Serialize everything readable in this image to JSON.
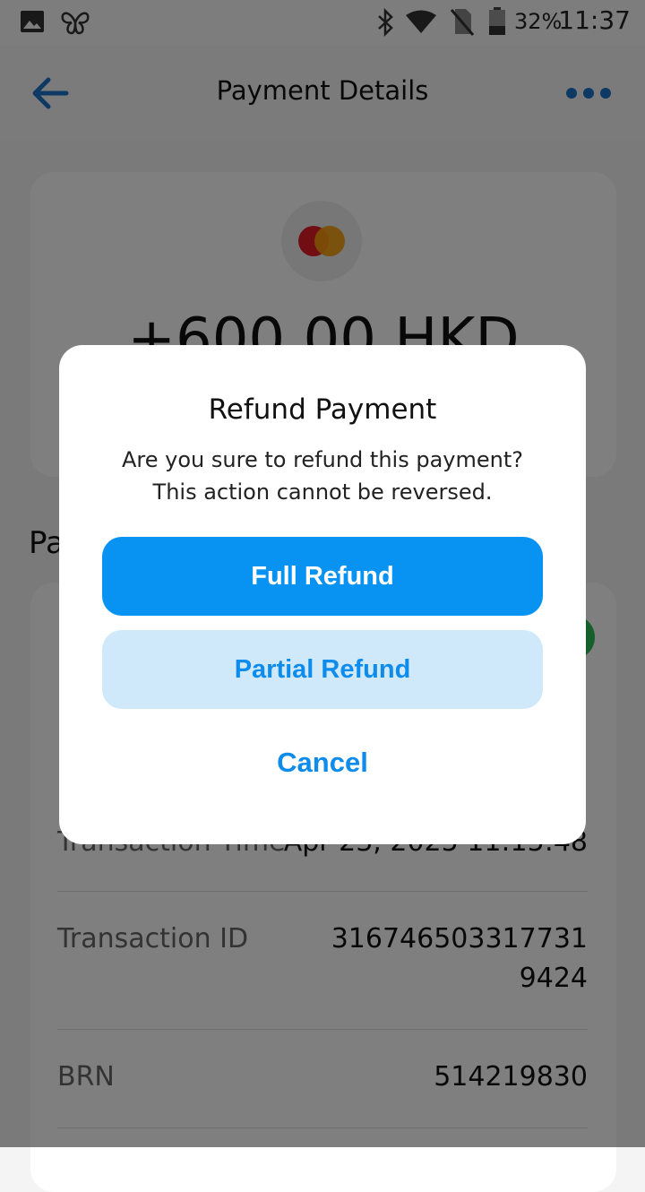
{
  "status_bar": {
    "icons": [
      "image-icon",
      "butterfly-icon",
      "bluetooth-icon",
      "wifi-icon",
      "no-sim-icon",
      "battery-icon"
    ],
    "battery": "32%",
    "time": "11:37"
  },
  "app_bar": {
    "title": "Payment Details",
    "back_icon": "arrow-left-icon",
    "more_icon": "more-horizontal-icon",
    "accent_color": "#1a73c8"
  },
  "summary": {
    "card_brand_icon": "mastercard-icon",
    "amount": "+600.00 HKD"
  },
  "details": {
    "section_heading_visible": "Pa",
    "rows": [
      {
        "label": "Transaction Time",
        "value": "Apr 23, 2025 11:15:48"
      },
      {
        "label": "Transaction ID",
        "value": "316746503317731",
        "value_line2": "9424"
      },
      {
        "label": "BRN",
        "value": "514219830"
      }
    ]
  },
  "dialog": {
    "title": "Refund Payment",
    "message_line1": "Are you sure to refund this payment?",
    "message_line2": "This action cannot be reversed.",
    "full_refund_label": "Full Refund",
    "partial_refund_label": "Partial Refund",
    "cancel_label": "Cancel",
    "primary_color": "#0893f3",
    "secondary_color": "#cfe9fb"
  }
}
